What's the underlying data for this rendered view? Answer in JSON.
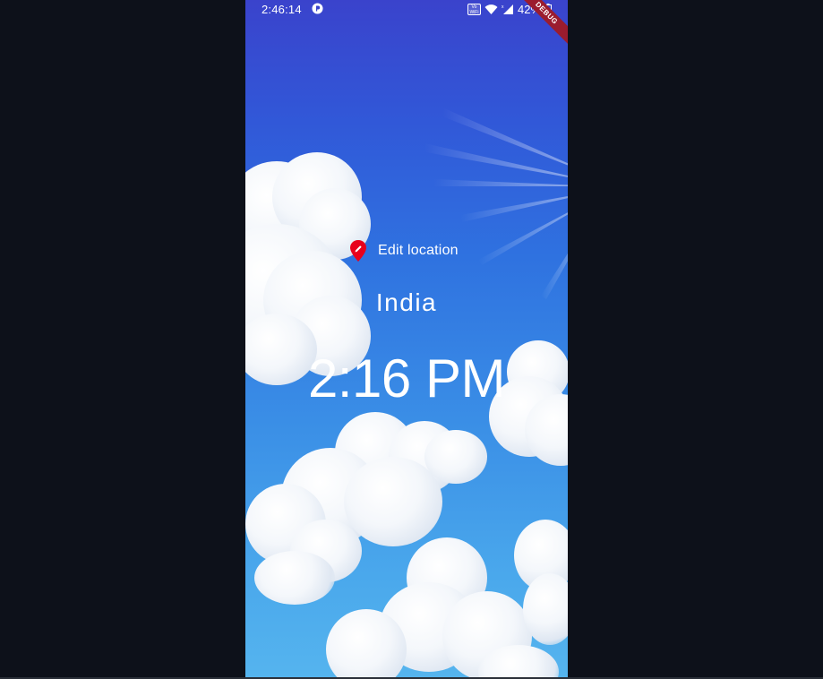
{
  "status_bar": {
    "time": "2:46:14",
    "vowifi_label": "Vo WiFi",
    "battery_percent": "42%"
  },
  "debug_banner": "DEBUG",
  "location": {
    "edit_label": "Edit location",
    "name": "India"
  },
  "clock": {
    "time": "2:16 PM"
  },
  "colors": {
    "background": "#0d111a",
    "sky_top": "#3a43cc",
    "sky_bottom": "#55b4ee",
    "pin": "#e8001c",
    "debug": "#9b1c2e"
  },
  "icons": {
    "status_app": "app-icon",
    "wifi": "wifi-icon",
    "signal": "cellular-signal-icon",
    "battery": "battery-icon",
    "location_pin": "location-pin-edit-icon"
  }
}
